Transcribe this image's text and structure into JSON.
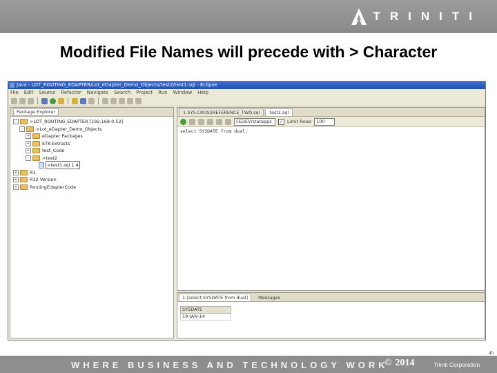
{
  "brand": {
    "name": "TRINITI",
    "accent": "#ffffff"
  },
  "slide": {
    "title": "Modified File Names will precede with > Character"
  },
  "eclipse": {
    "window_title": "Java - LOT_ROUTING_EDAPTER/Lot_eDapter_Demo_Objects/test2/test1.sql - Eclipse",
    "menu": [
      "File",
      "Edit",
      "Source",
      "Refactor",
      "Navigate",
      "Search",
      "Project",
      "Run",
      "Window",
      "Help"
    ],
    "left_tab": "Package Explorer",
    "tree": [
      {
        "label": ">LOT_ROUTING_EDAPTER [192.168.0.52]",
        "depth": 0,
        "expander": "-",
        "icon": "folder-icon"
      },
      {
        "label": ">Lot_eDapter_Demo_Objects",
        "depth": 1,
        "expander": "-",
        "icon": "folder-icon"
      },
      {
        "label": "eDapter Packages",
        "depth": 2,
        "expander": "+",
        "icon": "folder-icon"
      },
      {
        "label": "ETK-Extracts",
        "depth": 2,
        "expander": "+",
        "icon": "folder-icon"
      },
      {
        "label": "test_Code",
        "depth": 2,
        "expander": "+",
        "icon": "folder-icon"
      },
      {
        "label": ">test2",
        "depth": 2,
        "expander": "-",
        "icon": "folder-icon"
      },
      {
        "label": ">test1.sql 1.4",
        "depth": 3,
        "expander": "",
        "icon": "sql-file-icon",
        "selected": true
      },
      {
        "label": "R1",
        "depth": 0,
        "expander": "+",
        "icon": "folder-icon"
      },
      {
        "label": "R12 Version",
        "depth": 0,
        "expander": "+",
        "icon": "folder-icon"
      },
      {
        "label": "RoutingEdapterCode",
        "depth": 0,
        "expander": "+",
        "icon": "folder-icon"
      }
    ],
    "editor_tabs": [
      {
        "label": "1 SYS.CROSSREFERENCE_TWO.sql",
        "active": false
      },
      {
        "label": "test1.sql",
        "active": true
      }
    ],
    "connection": "FEDEV/statapps",
    "limit_rows_label": "Limit Rows",
    "limit_rows_value": "100",
    "limit_rows_checked": true,
    "code": "select SYSDATE from dual;",
    "result_tabs": [
      {
        "label": "1 [select SYSDATE from dual]",
        "active": true
      },
      {
        "label": "Messages",
        "active": false
      }
    ],
    "result_column": "SYSDATE",
    "result_value": "19-JAN-14"
  },
  "footer": {
    "tagline": "WHERE BUSINESS AND TECHNOLOGY WORK",
    "copyright_symbol": "©",
    "year": "2014",
    "company": "Triniti Corporation"
  },
  "page_number": "40"
}
